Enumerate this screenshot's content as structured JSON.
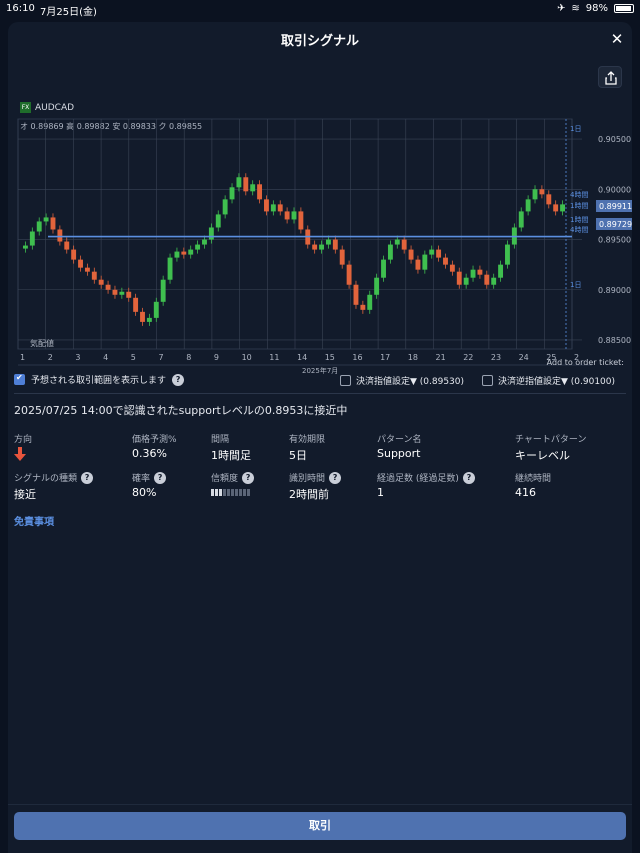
{
  "status": {
    "time": "16:10",
    "date": "7月25日(金)",
    "battery": "98%"
  },
  "modal": {
    "title": "取引シグナル"
  },
  "chart": {
    "symbol_badge": "FX",
    "symbol": "AUDCAD",
    "ohlc": "オ 0.89869  高 0.89882  安 0.89833  ク 0.89855",
    "month_label": "2025年7月",
    "volume_label": "気配値",
    "price_tags": {
      "upper": "0.89911",
      "lower": "0.89729"
    },
    "period_labels": [
      "1日",
      "1日",
      "4時間",
      "1時間",
      "1時間",
      "4時間"
    ]
  },
  "chart_data": {
    "type": "line",
    "title": "",
    "y_ticks": [
      0.905,
      0.9,
      0.895,
      0.89,
      0.885
    ],
    "ylim": [
      0.8845,
      0.907
    ],
    "x_tick_labels": [
      "1",
      "2",
      "3",
      "4",
      "5",
      "7",
      "8",
      "9",
      "10",
      "11",
      "14",
      "15",
      "16",
      "17",
      "18",
      "21",
      "22",
      "23",
      "24",
      "25",
      "2"
    ],
    "xlabel": "2025年7月",
    "support_level": 0.8953,
    "series": [
      {
        "values": [
          0.8944,
          0.8958,
          0.8968,
          0.8972,
          0.896,
          0.8948,
          0.894,
          0.893,
          0.8922,
          0.8918,
          0.891,
          0.8905,
          0.89,
          0.8895,
          0.8898,
          0.8892,
          0.8878,
          0.8868,
          0.8872,
          0.8888,
          0.891,
          0.8932,
          0.8938,
          0.8935,
          0.894,
          0.8945,
          0.895,
          0.8962,
          0.8975,
          0.899,
          0.9002,
          0.9012,
          0.8998,
          0.9005,
          0.899,
          0.8978,
          0.8985,
          0.8978,
          0.897,
          0.8978,
          0.896,
          0.8945,
          0.894,
          0.8945,
          0.895,
          0.894,
          0.8925,
          0.8905,
          0.8885,
          0.888,
          0.8895,
          0.8912,
          0.893,
          0.8945,
          0.895,
          0.894,
          0.893,
          0.892,
          0.8935,
          0.894,
          0.8932,
          0.8925,
          0.8918,
          0.8905,
          0.8912,
          0.892,
          0.8915,
          0.8905,
          0.8912,
          0.8925,
          0.8945,
          0.8962,
          0.8978,
          0.899,
          0.9,
          0.8995,
          0.8985,
          0.8978,
          0.8985
        ]
      }
    ]
  },
  "order_ticket": {
    "title": "Add to order ticket:",
    "show_range_label": "予想される取引範囲を表示します",
    "take_profit_label": "決済指値設定▼ (0.89530)",
    "stop_loss_label": "決済逆指値設定▼ (0.90100)"
  },
  "signal": {
    "description": "2025/07/25 14:00で認識されたsupportレベルの0.8953に接近中",
    "direction_label": "方向",
    "price_forecast_label": "価格予測%",
    "price_forecast": "0.36%",
    "interval_label": "間隔",
    "interval": "1時間足",
    "expiry_label": "有効期限",
    "expiry": "5日",
    "pattern_name_label": "パターン名",
    "pattern_name": "Support",
    "chart_pattern_label": "チャートパターン",
    "chart_pattern": "キーレベル",
    "signal_type_label": "シグナルの種類",
    "signal_type": "接近",
    "probability_label": "確率",
    "probability": "80%",
    "reliability_label": "信頼度",
    "reliability_level": 0.3,
    "identified_time_label": "識別時間",
    "identified_time": "2時間前",
    "bars_elapsed_label": "経過足数 (経過足数)",
    "bars_elapsed": "1",
    "duration_label": "継続時間",
    "duration": "416"
  },
  "disclaimer": "免責事項",
  "trade_button": "取引"
}
